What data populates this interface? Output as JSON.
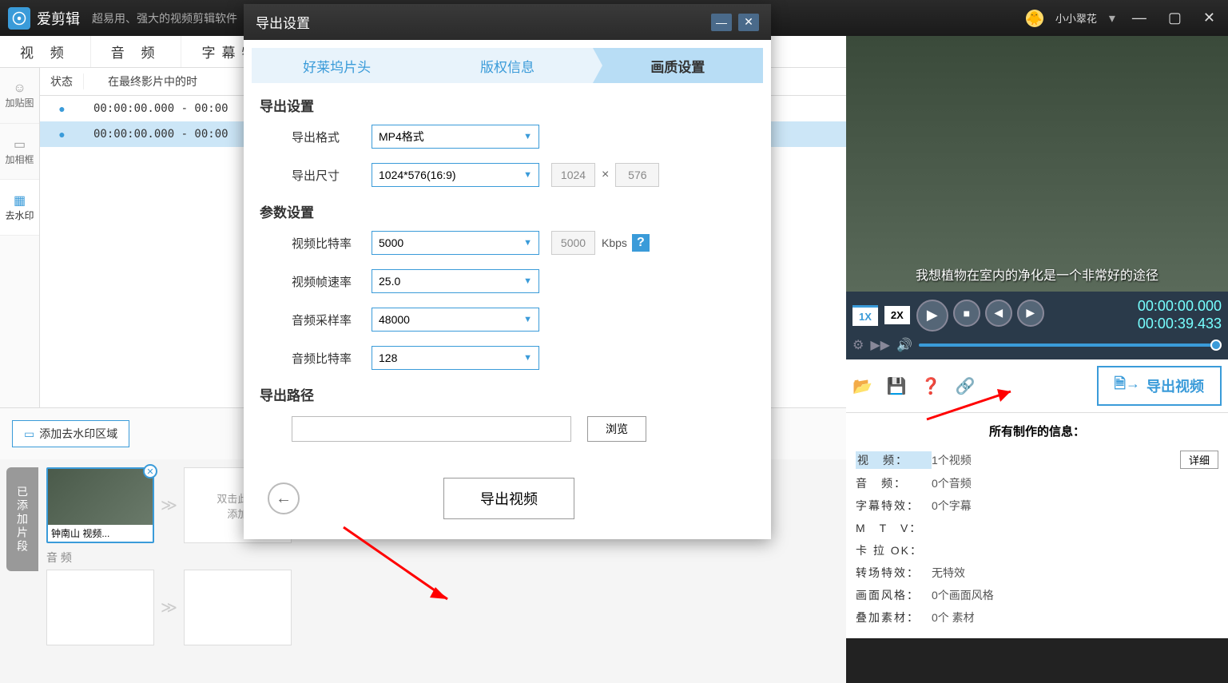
{
  "app": {
    "name": "爱剪辑",
    "slogan": "超易用、强大的视频剪辑软件"
  },
  "user": {
    "name": "小小翠花"
  },
  "mainTabs": [
    "视 频",
    "音 频",
    "字幕特效"
  ],
  "sideTools": [
    {
      "label": "加贴图"
    },
    {
      "label": "加相框"
    },
    {
      "label": "去水印"
    }
  ],
  "clipList": {
    "header": {
      "col1": "状态",
      "col2": "在最终影片中的时"
    },
    "rows": [
      {
        "time": "00:00:00.000 - 00:00"
      },
      {
        "time": "00:00:00.000 - 00:00"
      }
    ]
  },
  "wmButton": "添加去水印区域",
  "timeline": {
    "tab": "已添加片段",
    "clipLabel": "钟南山 视频...",
    "emptySlot": "双击此处\n添加",
    "audioLabel": "音 频"
  },
  "preview": {
    "subtitle": "我想植物在室内的净化是一个非常好的途径",
    "speeds": [
      "1X",
      "2X"
    ],
    "time1": "00:00:00.000",
    "time2": "00:00:39.433",
    "exportBtn": "导出视频"
  },
  "info": {
    "title": "所有制作的信息：",
    "rows": [
      {
        "label": "视　频：",
        "value": "1个视频",
        "detail": "详细",
        "sel": true
      },
      {
        "label": "音　频：",
        "value": "0个音频"
      },
      {
        "label": "字幕特效：",
        "value": "0个字幕"
      },
      {
        "label": "M　T　V：",
        "value": ""
      },
      {
        "label": "卡 拉 OK：",
        "value": ""
      },
      {
        "label": "转场特效：",
        "value": "无特效"
      },
      {
        "label": "画面风格：",
        "value": "0个画面风格"
      },
      {
        "label": "叠加素材：",
        "value": "0个 素材"
      }
    ]
  },
  "dialog": {
    "title": "导出设置",
    "steps": [
      "好莱坞片头",
      "版权信息",
      "画质设置"
    ],
    "section1": "导出设置",
    "formatLabel": "导出格式",
    "formatValue": "MP4格式",
    "sizeLabel": "导出尺寸",
    "sizeValue": "1024*576(16:9)",
    "width": "1024",
    "height": "576",
    "section2": "参数设置",
    "vbitrateLabel": "视频比特率",
    "vbitrateValue": "5000",
    "vbitrateUnit": "Kbps",
    "fpsLabel": "视频帧速率",
    "fpsValue": "25.0",
    "asampleLabel": "音频采样率",
    "asampleValue": "48000",
    "abitrateLabel": "音频比特率",
    "abitrateValue": "128",
    "section3": "导出路径",
    "browseBtn": "浏览",
    "exportBtn": "导出视频"
  }
}
